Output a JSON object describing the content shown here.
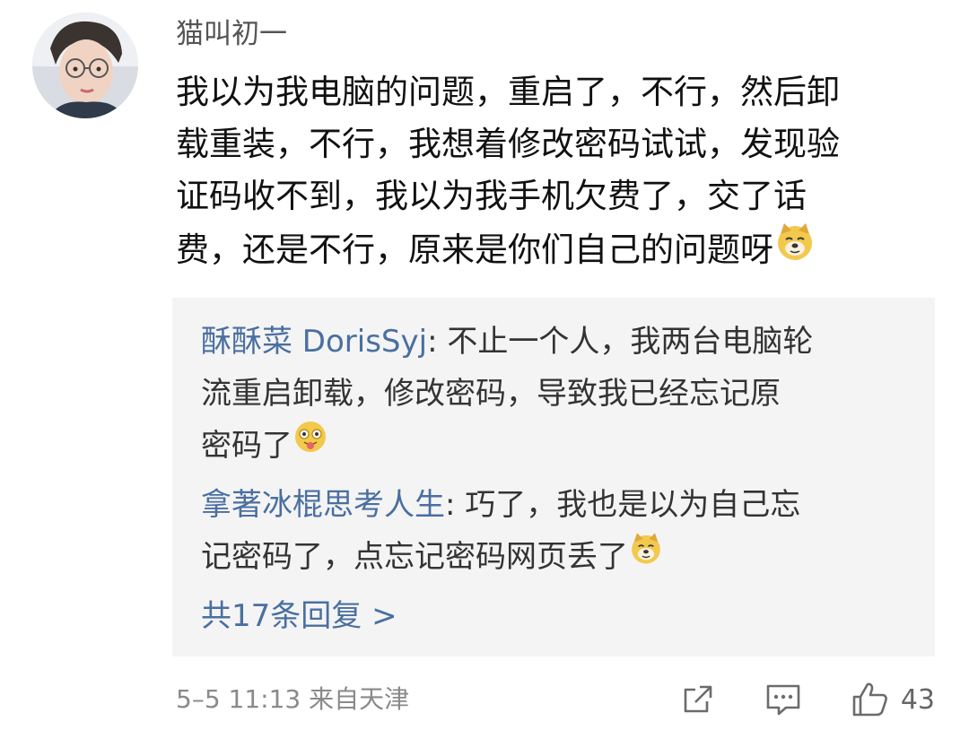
{
  "comment": {
    "username": "猫叫初一",
    "lines": [
      "我以为我电脑的问题，重启了，不行，然后卸",
      "载重装，不行，我想着修改密码试试，发现验",
      "证码收不到，我以为我手机欠费了，交了话",
      "费，还是不行，原来是你们自己的问题呀"
    ],
    "emoji": "doge-emoji"
  },
  "replies": [
    {
      "name": "酥酥菜 DorisSyj",
      "first_text": ": 不止一个人，我两台电脑轮",
      "lines": [
        "流重启卸载，修改密码，导致我已经忘记原",
        "密码了"
      ],
      "emoji": "tongue-out-emoji"
    },
    {
      "name": "拿著冰棍思考人生",
      "first_text": ": 巧了，我也是以为自己忘",
      "lines": [
        "记密码了，点忘记密码网页丢了"
      ],
      "emoji": "doge-emoji"
    }
  ],
  "more_replies": "共17条回复 >",
  "footer": {
    "meta": "5–5 11:13  来自天津",
    "like_count": "43",
    "icons": [
      "share-icon",
      "comment-icon",
      "like-icon"
    ]
  },
  "colors": {
    "link_blue": "#4a6fa0",
    "reply_bg": "#f4f4f4",
    "meta_gray": "#8a8a8a",
    "emoji_yellow": "#f2c94c"
  }
}
